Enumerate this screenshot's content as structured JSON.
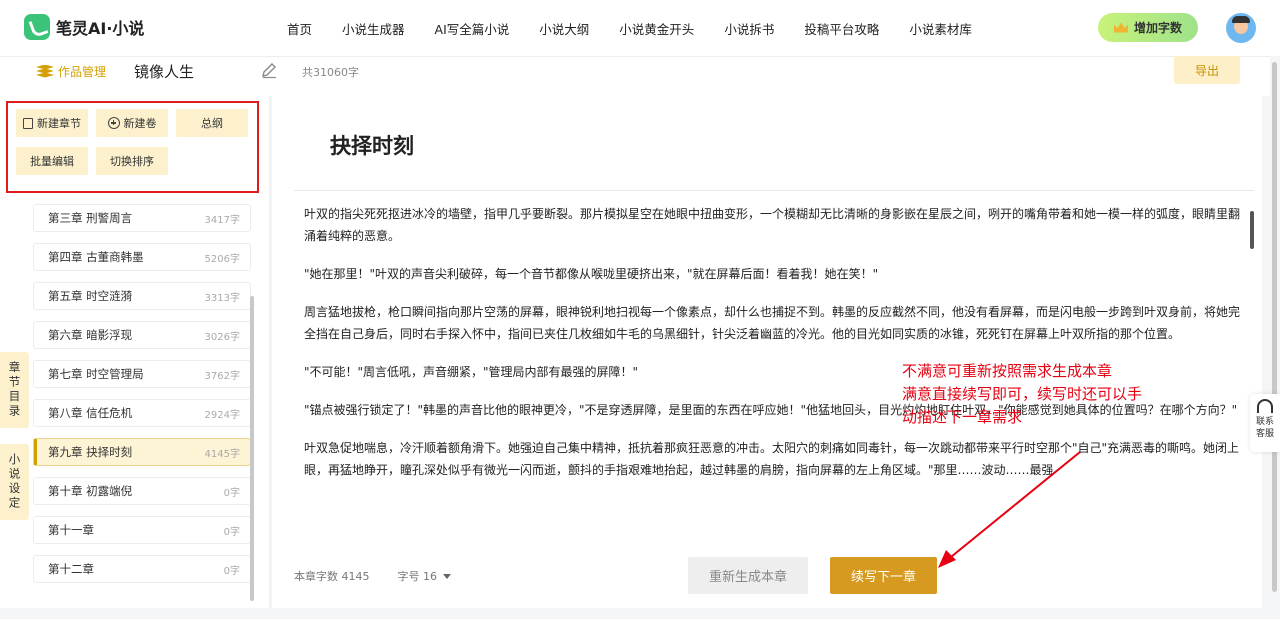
{
  "app": {
    "name": "笔灵AI·小说"
  },
  "nav": {
    "items": [
      "首页",
      "小说生成器",
      "AI写全篇小说",
      "小说大纲",
      "小说黄金开头",
      "小说拆书",
      "投稿平台攻略",
      "小说素材库"
    ]
  },
  "account": {
    "add_words": "增加字数"
  },
  "workbar": {
    "works_label": "作品管理",
    "book_title": "镜像人生",
    "word_count": "共31060字",
    "export": "导出"
  },
  "toolbar": {
    "new_chapter": "新建章节",
    "new_volume": "新建卷",
    "outline": "总纲",
    "batch_edit": "批量编辑",
    "switch_sort": "切换排序"
  },
  "chapters": [
    {
      "title": "第三章 刑警周言",
      "words": "3417字"
    },
    {
      "title": "第四章 古董商韩墨",
      "words": "5206字"
    },
    {
      "title": "第五章 时空涟漪",
      "words": "3313字"
    },
    {
      "title": "第六章 暗影浮现",
      "words": "3026字"
    },
    {
      "title": "第七章 时空管理局",
      "words": "3762字"
    },
    {
      "title": "第八章 信任危机",
      "words": "2924字"
    },
    {
      "title": "第九章 抉择时刻",
      "words": "4145字"
    },
    {
      "title": "第十章 初露端倪",
      "words": "0字"
    },
    {
      "title": "第十一章",
      "words": "0字"
    },
    {
      "title": "第十二章",
      "words": "0字"
    }
  ],
  "side_tabs": {
    "catalog": "章节目录",
    "settings": "小说设定"
  },
  "editor": {
    "heading": "抉择时刻",
    "paragraphs": [
      "叶双的指尖死死抠进冰冷的墙壁，指甲几乎要断裂。那片模拟星空在她眼中扭曲变形，一个模糊却无比清晰的身影嵌在星辰之间，咧开的嘴角带着和她一模一样的弧度，眼睛里翻涌着纯粹的恶意。",
      "\"她在那里！\"叶双的声音尖利破碎，每一个音节都像从喉咙里硬挤出来，\"就在屏幕后面！看着我！她在笑！\"",
      "周言猛地拔枪，枪口瞬间指向那片空荡的屏幕，眼神锐利地扫视每一个像素点，却什么也捕捉不到。韩墨的反应截然不同，他没有看屏幕，而是闪电般一步跨到叶双身前，将她完全挡在自己身后，同时右手探入怀中，指间已夹住几枚细如牛毛的乌黑细针，针尖泛着幽蓝的冷光。他的目光如同实质的冰锥，死死钉在屏幕上叶双所指的那个位置。",
      "\"不可能！\"周言低吼，声音绷紧，\"管理局内部有最强的屏障！\"",
      "\"锚点被强行锁定了！\"韩墨的声音比他的眼神更冷，\"不是穿透屏障，是里面的东西在呼应她！\"他猛地回头，目光灼灼地盯住叶双，\"你能感觉到她具体的位置吗？在哪个方向？\"",
      "叶双急促地喘息，冷汗顺着额角滑下。她强迫自己集中精神，抵抗着那疯狂恶意的冲击。太阳穴的刺痛如同毒针，每一次跳动都带来平行时空那个\"自己\"充满恶毒的嘶鸣。她闭上眼，再猛地睁开，瞳孔深处似乎有微光一闪而逝，颤抖的手指艰难地抬起，越过韩墨的肩膀，指向屏幕的左上角区域。\"那里……波动……最强"
    ],
    "annotation": [
      "不满意可重新按照需求生成本章",
      "满意直接续写即可，续写时还可以手",
      "动描述下一章需求"
    ],
    "chapter_words": "本章字数 4145",
    "font_size": "字号 16",
    "regenerate": "重新生成本章",
    "continue": "续写下一章"
  },
  "help": {
    "line1": "联系",
    "line2": "客服"
  }
}
